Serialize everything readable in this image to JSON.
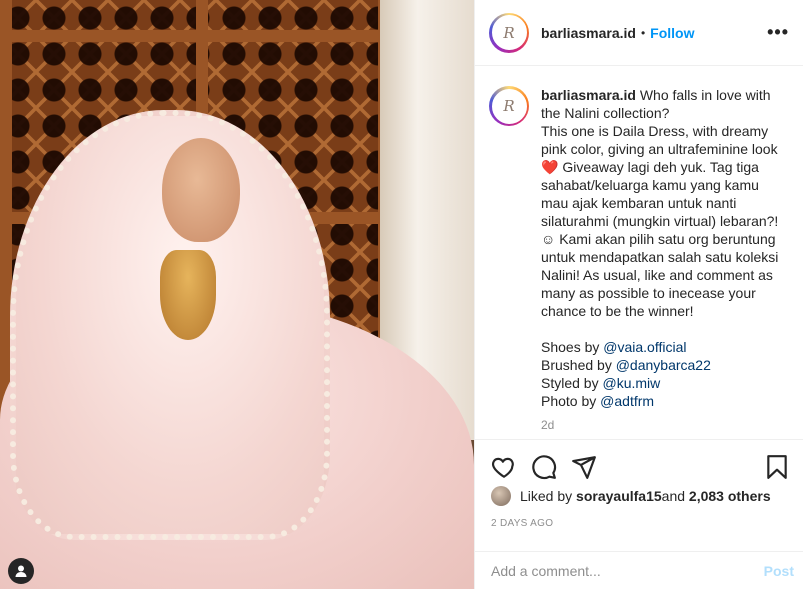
{
  "post": {
    "username": "barliasmara.id",
    "follow_label": "Follow",
    "separator": "•",
    "more_label": "•••",
    "logo_text": "R"
  },
  "caption": {
    "username": "barliasmara.id",
    "line1": "Who falls in love with the Nalini collection?",
    "line2": "This one is Daila Dress, with dreamy pink color, giving an ultrafeminine look",
    "heart": "❤️",
    "line3": "Giveaway lagi deh yuk. Tag tiga sahabat/keluarga kamu yang kamu mau ajak kembaran untuk nanti silaturahmi (mungkin virtual) lebaran?!",
    "smile": "☺",
    "line4": "Kami akan pilih satu org beruntung untuk mendapatkan salah satu koleksi Nalini! As usual, like and comment as many as possible to inecease your chance to be the winner!",
    "credits": [
      {
        "prefix": "Shoes by ",
        "handle": "@vaia.official"
      },
      {
        "prefix": "Brushed by ",
        "handle": "@danybarca22"
      },
      {
        "prefix": "Styled by ",
        "handle": "@ku.miw"
      },
      {
        "prefix": "Photo by ",
        "handle": "@adtfrm"
      }
    ],
    "time_short": "2d"
  },
  "likes": {
    "prefix": "Liked by ",
    "user": "sorayaulfa15",
    "middle": " and ",
    "others": "2,083 others"
  },
  "date": "2 DAYS AGO",
  "comment": {
    "placeholder": "Add a comment...",
    "post_label": "Post"
  },
  "icons": [
    "heart-icon",
    "comment-icon",
    "share-icon",
    "bookmark-icon",
    "user-tag-icon"
  ],
  "colors": {
    "link": "#0095f6",
    "mention": "#00376b",
    "muted": "#8e8e8e",
    "post_disabled": "#b2dffc"
  }
}
